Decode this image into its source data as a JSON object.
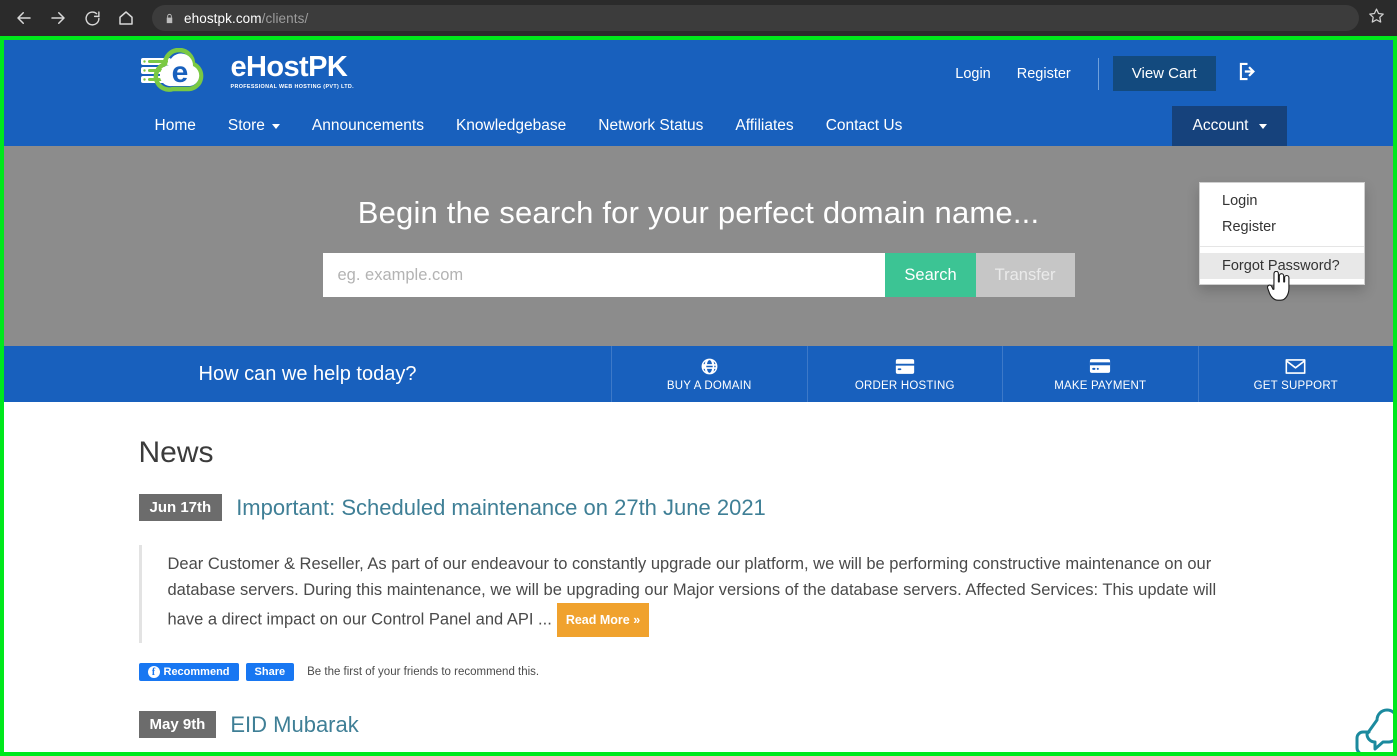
{
  "browser": {
    "back_icon": "arrow-left-icon",
    "forward_icon": "arrow-right-icon",
    "reload_icon": "reload-icon",
    "home_icon": "home-icon",
    "lock_icon": "lock-icon",
    "url_domain": "ehostpk.com",
    "url_path": "/clients/",
    "bookmark_icon": "star-icon"
  },
  "header": {
    "logo": {
      "word": "eHostPK",
      "tagline": "PROFESSIONAL WEB HOSTING (PVT) LTD.",
      "icon": "ehostpk-cloud-server-logo"
    },
    "top_links": [
      {
        "label": "Login"
      },
      {
        "label": "Register"
      }
    ],
    "cart_label": "View Cart",
    "logout_icon": "logout-icon",
    "nav": [
      {
        "label": "Home",
        "has_caret": false
      },
      {
        "label": "Store",
        "has_caret": true
      },
      {
        "label": "Announcements",
        "has_caret": false
      },
      {
        "label": "Knowledgebase",
        "has_caret": false
      },
      {
        "label": "Network Status",
        "has_caret": false
      },
      {
        "label": "Affiliates",
        "has_caret": false
      },
      {
        "label": "Contact Us",
        "has_caret": false
      }
    ],
    "account_label": "Account",
    "account_caret_icon": "chevron-down-icon"
  },
  "dropdown": {
    "items": [
      {
        "label": "Login",
        "hovered": false
      },
      {
        "label": "Register",
        "hovered": false
      },
      {
        "label": "Forgot Password?",
        "hovered": true
      }
    ]
  },
  "hero": {
    "title": "Begin the search for your perfect domain name...",
    "search_placeholder": "eg. example.com",
    "search_value": "",
    "search_button": "Search",
    "transfer_button": "Transfer"
  },
  "quickbar": {
    "label": "How can we help today?",
    "items": [
      {
        "label": "BUY A DOMAIN",
        "icon": "globe-icon"
      },
      {
        "label": "ORDER HOSTING",
        "icon": "server-icon"
      },
      {
        "label": "MAKE PAYMENT",
        "icon": "credit-card-icon"
      },
      {
        "label": "GET SUPPORT",
        "icon": "envelope-icon"
      }
    ]
  },
  "news": {
    "heading": "News",
    "articles": [
      {
        "date": "Jun 17th",
        "title": "Important: Scheduled maintenance on 27th June 2021",
        "body": "Dear Customer & Reseller, As part of our endeavour to constantly upgrade our platform, we will be performing constructive maintenance on our database servers. During this maintenance, we will be upgrading our Major versions of the database servers. Affected Services:  This update will have a direct impact on our Control Panel and API ...",
        "read_more": "Read More »",
        "social": {
          "recommend_label": "Recommend",
          "share_label": "Share",
          "note": "Be the first of your friends to recommend this.",
          "fb_glyph": "f"
        }
      },
      {
        "date": "May 9th",
        "title": "EID Mubarak"
      }
    ]
  },
  "colors": {
    "brand_blue": "#1860bd",
    "dark_blue": "#134a7e",
    "account_blue": "#16427c",
    "green_accent": "#3cc494",
    "highlight_border": "#00e81c",
    "hero_gray": "#8c8c8c",
    "link_teal": "#3f7f96",
    "badge_gray": "#6c6c6c",
    "read_more_orange": "#f0a22e",
    "facebook_blue": "#1877f2"
  }
}
